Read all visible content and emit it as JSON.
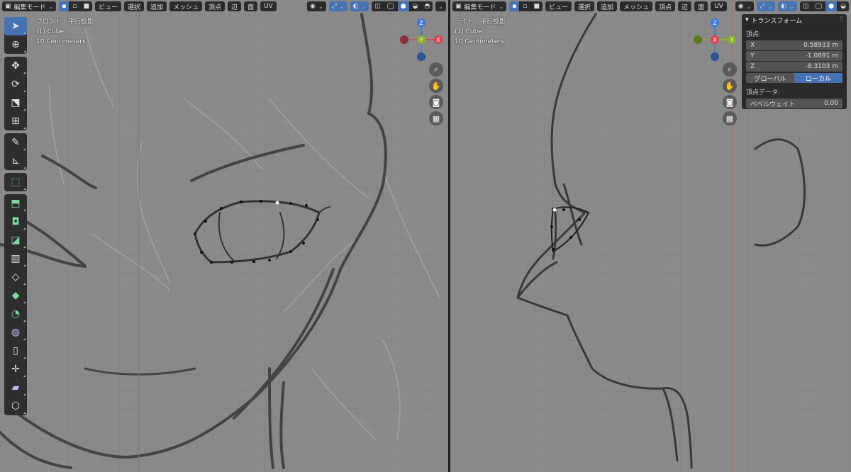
{
  "left_viewport": {
    "mode": "編集モード",
    "menus": [
      "ビュー",
      "選択",
      "追加",
      "メッシュ",
      "頂点",
      "辺",
      "面",
      "UV"
    ],
    "view_name": "フロント・平行投影",
    "object_name": "(1) Cube",
    "scale": "10 Centimeters",
    "gizmo": {
      "top": "Z",
      "left": "",
      "center": "Y",
      "right": "X"
    }
  },
  "right_viewport": {
    "mode": "編集モード",
    "menus": [
      "ビュー",
      "選択",
      "追加",
      "メッシュ",
      "頂点",
      "辺",
      "面",
      "UV"
    ],
    "view_name": "ライト・平行投影",
    "object_name": "(1) Cube",
    "scale": "10 Centimeters",
    "gizmo": {
      "top": "Z",
      "left": "",
      "center": "X",
      "right": "Y"
    }
  },
  "transform_panel": {
    "title": "トランスフォーム",
    "vertex_label": "頂点:",
    "x_label": "X",
    "x_value": "0.58933 m",
    "y_label": "Y",
    "y_value": "-1.0891 m",
    "z_label": "Z",
    "z_value": "-8.3103 m",
    "global_label": "グローバル",
    "local_label": "ローカル",
    "vertex_data_label": "頂点データ:",
    "bevel_label": "ベベルウェイト",
    "bevel_value": "0.00"
  },
  "colors": {
    "accent": "#4772b3",
    "x_axis": "#d9434f",
    "y_axis": "#8ab429",
    "z_axis": "#3b7ad9"
  }
}
